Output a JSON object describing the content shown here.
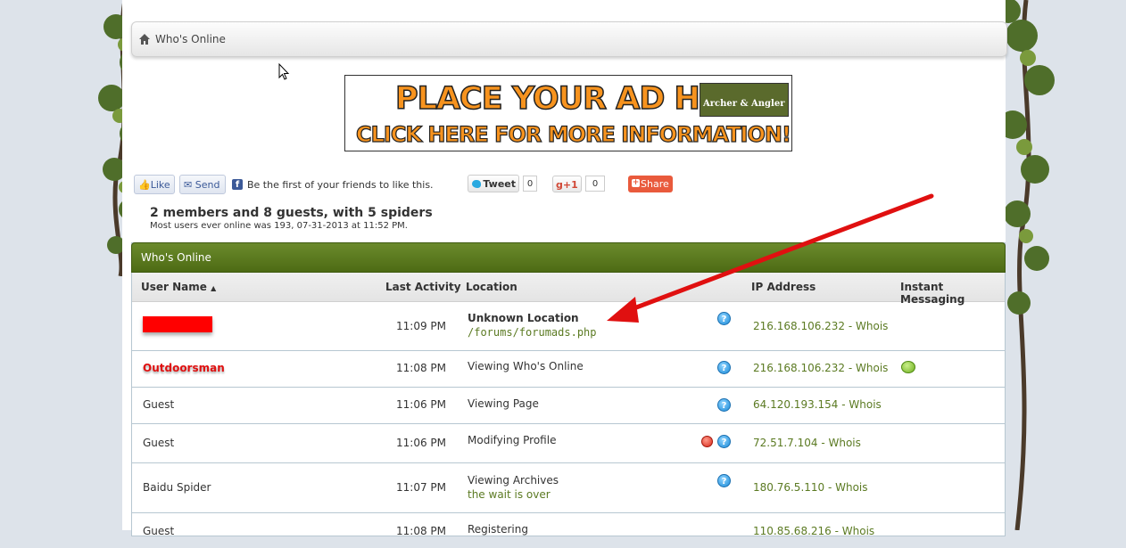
{
  "breadcrumb": {
    "title": "Who's Online",
    "icon": "home-icon"
  },
  "ad": {
    "line1": "PLACE YOUR AD HERE!",
    "line2": "CLICK HERE FOR MORE INFORMATION!",
    "logo": "Archer & Angler"
  },
  "social": {
    "like": "Like",
    "send": "Send",
    "fb_text": "Be the first of your friends to like this.",
    "tweet": "Tweet",
    "tweet_count": "0",
    "gplus": "+1",
    "gplus_count": "0",
    "share": "Share"
  },
  "summary": {
    "headline": "2 members and 8 guests, with 5 spiders",
    "record": "Most users ever online was 193, 07-31-2013 at 11:52 PM."
  },
  "table": {
    "title": "Who's Online",
    "columns": {
      "user": "User Name",
      "sort": "▲",
      "activity": "Last Activity",
      "location": "Location",
      "ip": "IP Address",
      "im": "Instant Messaging"
    },
    "rows": [
      {
        "user": "",
        "time": "11:09 PM",
        "loc": "Unknown Location",
        "sub": "/forums/forumads.php",
        "ip": "216.168.106.232 - Whois"
      },
      {
        "user": "Outdoorsman",
        "time": "11:08 PM",
        "loc": "Viewing Who's Online",
        "sub": "",
        "ip": "216.168.106.232 - Whois"
      },
      {
        "user": "Guest",
        "time": "11:06 PM",
        "loc": "Viewing Page",
        "sub": "",
        "ip": "64.120.193.154 - Whois"
      },
      {
        "user": "Guest",
        "time": "11:06 PM",
        "loc": "Modifying Profile",
        "sub": "",
        "ip": "72.51.7.104 - Whois"
      },
      {
        "user": "Baidu Spider",
        "time": "11:07 PM",
        "loc": "Viewing Archives",
        "sub": "the wait is over",
        "ip": "180.76.5.110 - Whois"
      },
      {
        "user": "Guest",
        "time": "11:08 PM",
        "loc": "Registering",
        "sub": "",
        "ip": "110.85.68.216 - Whois"
      }
    ]
  },
  "colors": {
    "accent_green": "#5b7a22",
    "header_green": "#4d6b14",
    "annotation_red": "#e01010"
  }
}
